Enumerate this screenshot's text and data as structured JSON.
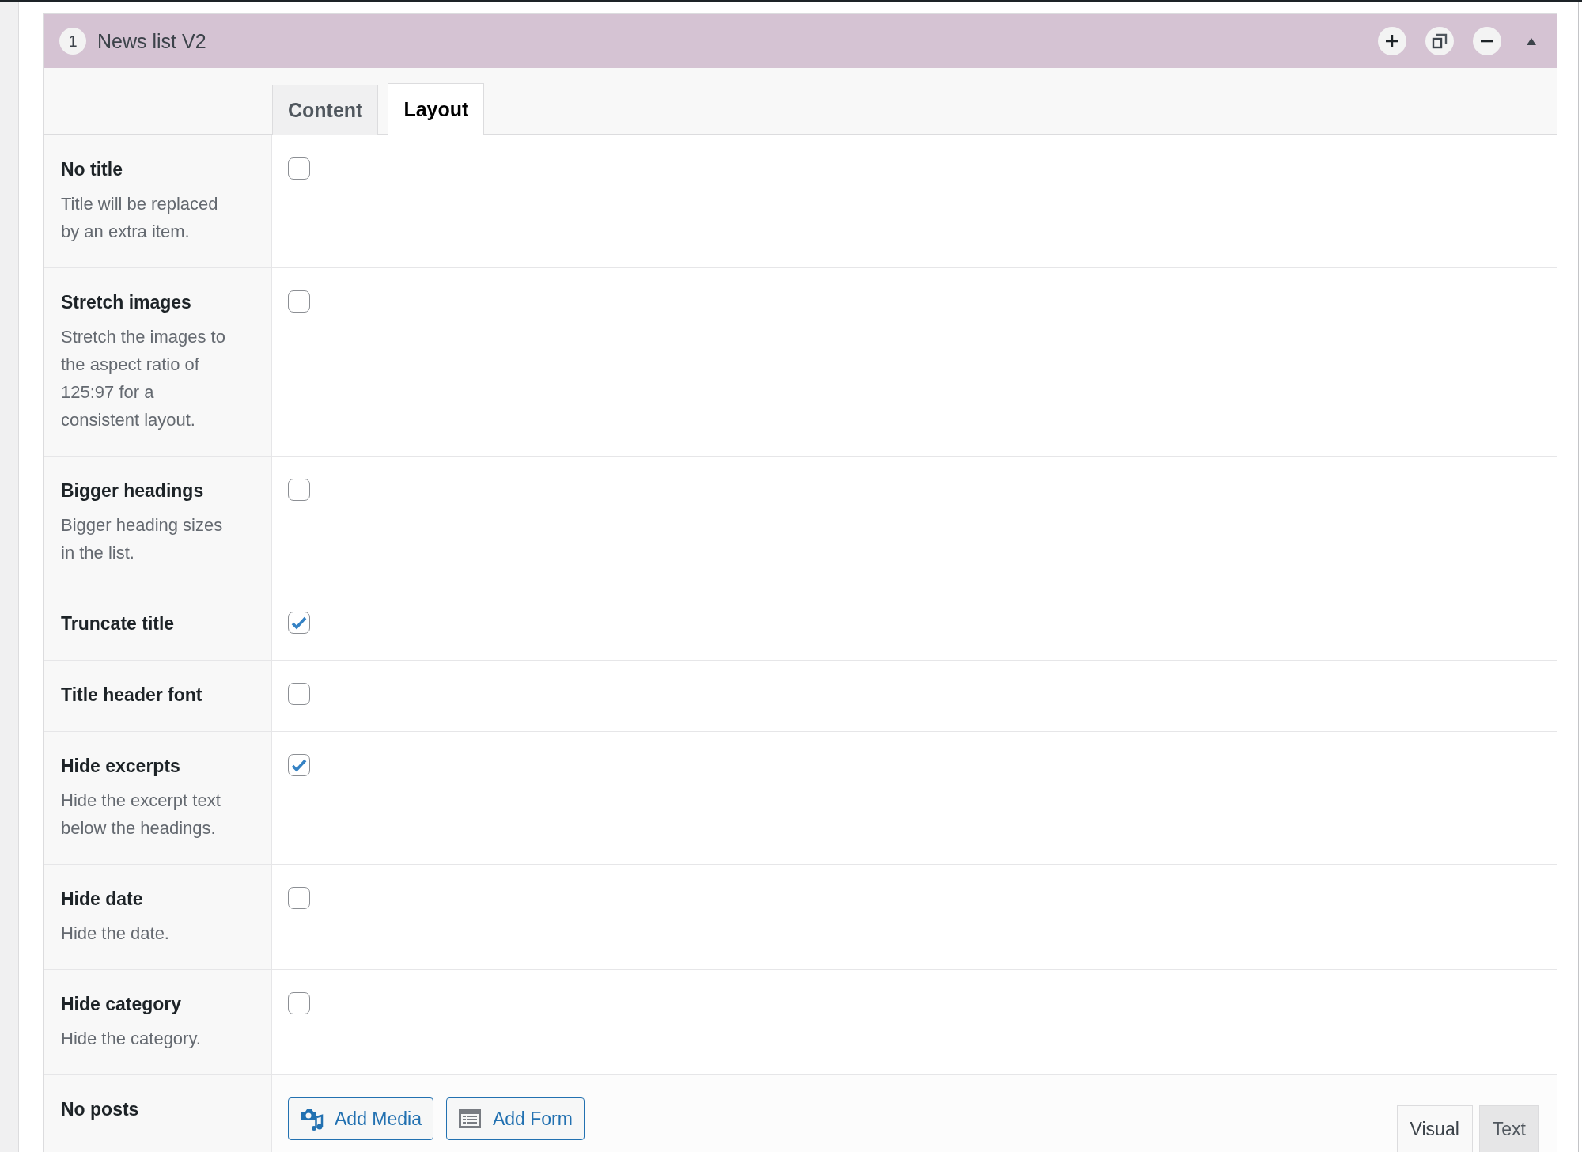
{
  "block": {
    "number": "1",
    "title": "News list V2"
  },
  "tabs": [
    {
      "label": "Content",
      "selected": false
    },
    {
      "label": "Layout",
      "selected": true
    }
  ],
  "options": [
    {
      "label": "No title",
      "description": "Title will be replaced by an extra item.",
      "checked": false
    },
    {
      "label": "Stretch images",
      "description": "Stretch the images to the aspect ratio of 125:97 for a consistent layout.",
      "checked": false
    },
    {
      "label": "Bigger headings",
      "description": "Bigger heading sizes in the list.",
      "checked": false
    },
    {
      "label": "Truncate title",
      "checked": true
    },
    {
      "label": "Title header font",
      "checked": false
    },
    {
      "label": "Hide excerpts",
      "description": "Hide the excerpt text below the headings.",
      "checked": true
    },
    {
      "label": "Hide date",
      "description": "Hide the date.",
      "checked": false
    },
    {
      "label": "Hide category",
      "description": "Hide the category.",
      "checked": false
    }
  ],
  "no_posts": {
    "label": "No posts",
    "buttons": [
      {
        "label": "Add Media",
        "kind": "media"
      },
      {
        "label": "Add Form",
        "kind": "form"
      }
    ],
    "editor_tabs": [
      {
        "label": "Visual",
        "selected": true
      },
      {
        "label": "Text",
        "selected": false
      }
    ]
  }
}
